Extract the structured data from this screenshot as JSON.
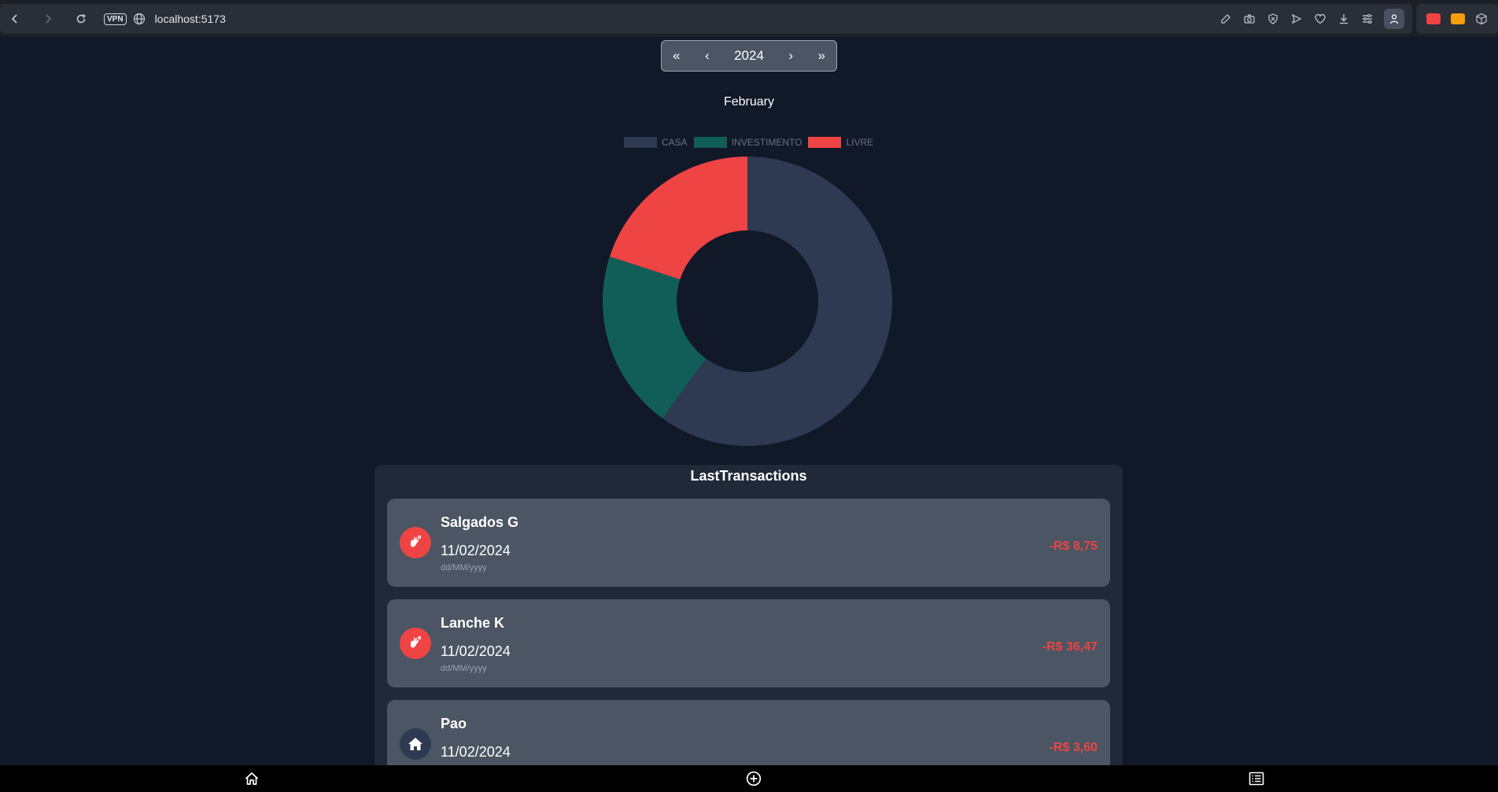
{
  "browser": {
    "url": "localhost:5173",
    "vpn_label": "VPN",
    "back_icon": "chevron-left-icon",
    "forward_icon": "chevron-right-icon",
    "reload_icon": "reload-icon"
  },
  "pager": {
    "first": "«",
    "prev": "‹",
    "year": "2024",
    "next": "›",
    "last": "»"
  },
  "month": "February",
  "chart_data": {
    "type": "pie",
    "variant": "doughnut",
    "title": "",
    "legend_position": "top",
    "categories": [
      "CASA",
      "INVESTIMENTO",
      "LIVRE"
    ],
    "values": [
      60,
      20,
      20
    ],
    "colors": [
      "#2d3a52",
      "#115e59",
      "#ef4444"
    ]
  },
  "transactions": {
    "title": "LastTransactions",
    "items": [
      {
        "name": "Salgados G",
        "date": "11/02/2024",
        "date_format": "dd/MM/yyyy",
        "amount": "-R$ 8,75",
        "icon": "snack-hand-icon",
        "icon_bg": "#ef4444"
      },
      {
        "name": "Lanche K",
        "date": "11/02/2024",
        "date_format": "dd/MM/yyyy",
        "amount": "-R$ 36,47",
        "icon": "snack-hand-icon",
        "icon_bg": "#ef4444"
      },
      {
        "name": "Pao",
        "date": "11/02/2024",
        "date_format": "",
        "amount": "-R$ 3,60",
        "icon": "house-icon",
        "icon_bg": "#2d3a52"
      }
    ]
  },
  "bottom_nav": {
    "home_icon": "home-icon",
    "add_icon": "plus-circle-icon",
    "list_icon": "list-icon"
  }
}
